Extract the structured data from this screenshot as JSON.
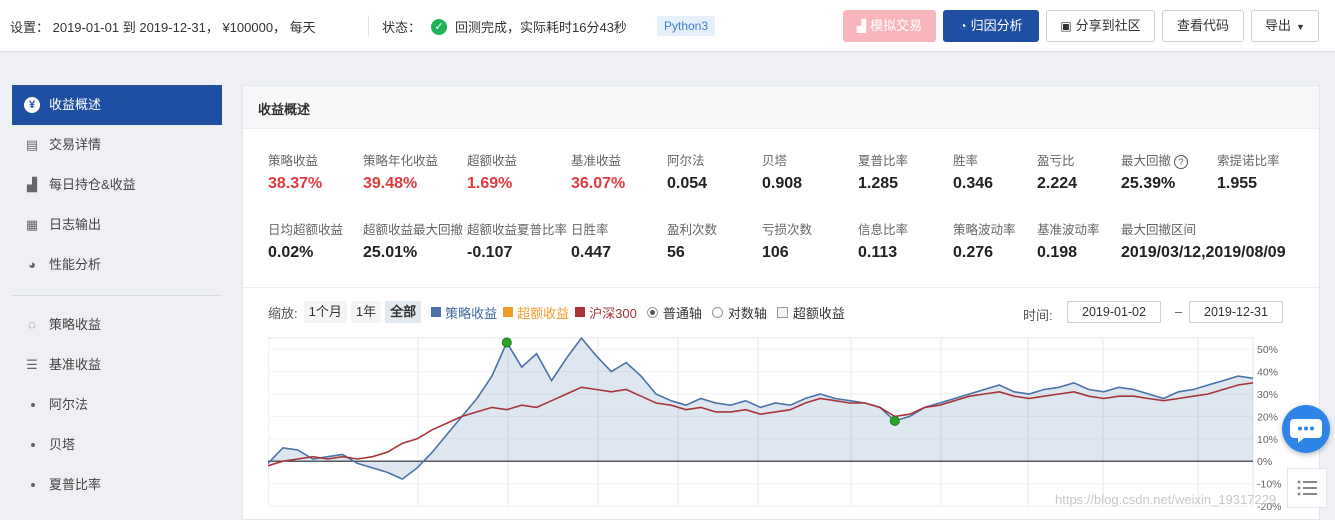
{
  "topbar": {
    "settings_text": "设置： 2019-01-01 到 2019-12-31， ¥100000， 每天",
    "status_label": "状态：",
    "status_text": "回测完成，实际耗时16分43秒",
    "python_badge": "Python3",
    "buttons": {
      "simulate": "模拟交易",
      "attribution": "归因分析",
      "share": "分享到社区",
      "view_code": "查看代码",
      "export": "导出"
    }
  },
  "sidebar": {
    "items": [
      {
        "label": "收益概述",
        "icon": "yen-icon"
      },
      {
        "label": "交易详情",
        "icon": "document-icon"
      },
      {
        "label": "每日持仓&收益",
        "icon": "bar-chart-icon"
      },
      {
        "label": "日志输出",
        "icon": "calendar-icon"
      },
      {
        "label": "性能分析",
        "icon": "pie-icon"
      },
      {
        "label": "策略收益",
        "icon": "bulb-icon"
      },
      {
        "label": "基准收益",
        "icon": "database-icon"
      },
      {
        "label": "阿尔法",
        "icon": "dot"
      },
      {
        "label": "贝塔",
        "icon": "dot"
      },
      {
        "label": "夏普比率",
        "icon": "dot"
      }
    ]
  },
  "panel": {
    "title": "收益概述",
    "metrics_row1": [
      {
        "label": "策略收益",
        "value": "38.37%",
        "color": "#e0393e"
      },
      {
        "label": "策略年化收益",
        "value": "39.48%",
        "color": "#e0393e"
      },
      {
        "label": "超额收益",
        "value": "1.69%",
        "color": "#e0393e"
      },
      {
        "label": "基准收益",
        "value": "36.07%",
        "color": "#e0393e"
      },
      {
        "label": "阿尔法",
        "value": "0.054"
      },
      {
        "label": "贝塔",
        "value": "0.908"
      },
      {
        "label": "夏普比率",
        "value": "1.285"
      },
      {
        "label": "胜率",
        "value": "0.346"
      },
      {
        "label": "盈亏比",
        "value": "2.224"
      },
      {
        "label": "最大回撤",
        "value": "25.39%"
      },
      {
        "label": "索提诺比率",
        "value": "1.955"
      }
    ],
    "metrics_row2": [
      {
        "label": "日均超额收益",
        "value": "0.02%"
      },
      {
        "label": "超额收益最大回撤",
        "value": "25.01%"
      },
      {
        "label": "超额收益夏普比率",
        "value": "-0.107"
      },
      {
        "label": "日胜率",
        "value": "0.447"
      },
      {
        "label": "盈利次数",
        "value": "56"
      },
      {
        "label": "亏损次数",
        "value": "106"
      },
      {
        "label": "信息比率",
        "value": "0.113"
      },
      {
        "label": "策略波动率",
        "value": "0.276"
      },
      {
        "label": "基准波动率",
        "value": "0.198"
      },
      {
        "label": "最大回撤区间",
        "value": "2019/03/12,2019/08/09"
      }
    ]
  },
  "chart_controls": {
    "zoom_label": "缩放:",
    "zoom_options": [
      "1个月",
      "1年",
      "全部"
    ],
    "zoom_selected": "全部",
    "legend": [
      {
        "label": "策略收益",
        "color": "#4a72a8"
      },
      {
        "label": "超额收益",
        "color": "#f59a2e"
      },
      {
        "label": "沪深300",
        "color": "#a8353a"
      }
    ],
    "axis_options": [
      {
        "label": "普通轴",
        "selected": true
      },
      {
        "label": "对数轴",
        "selected": false
      }
    ],
    "excess_checkbox": "超额收益",
    "time_label": "时间:",
    "date_from": "2019-01-02",
    "date_sep": "–",
    "date_to": "2019-12-31"
  },
  "chart_data": {
    "type": "line",
    "x_range": [
      "2019-01-02",
      "2019-12-31"
    ],
    "ylim": [
      -20,
      55
    ],
    "yticks": [
      "50%",
      "40%",
      "30%",
      "20%",
      "10%",
      "0%",
      "-10%",
      "-20%"
    ],
    "ytick_values": [
      50,
      40,
      30,
      20,
      10,
      0,
      -10,
      -20
    ],
    "series": [
      {
        "name": "策略收益",
        "color": "#4a72a8",
        "values": [
          -1,
          6,
          5,
          1,
          2,
          3,
          -1,
          -3,
          -5,
          -8,
          -3,
          4,
          12,
          20,
          28,
          38,
          53,
          42,
          48,
          36,
          46,
          55,
          47,
          40,
          44,
          38,
          30,
          27,
          25,
          28,
          26,
          25,
          27,
          24,
          26,
          25,
          28,
          30,
          28,
          27,
          26,
          24,
          18,
          20,
          24,
          26,
          28,
          30,
          32,
          34,
          31,
          30,
          32,
          33,
          35,
          32,
          31,
          33,
          32,
          30,
          28,
          31,
          32,
          34,
          36,
          38,
          37
        ]
      },
      {
        "name": "沪深300",
        "color": "#a8353a",
        "values": [
          -2,
          0,
          1,
          2,
          1,
          2,
          1,
          2,
          4,
          8,
          10,
          14,
          17,
          20,
          22,
          24,
          23,
          25,
          24,
          27,
          30,
          33,
          32,
          31,
          32,
          29,
          26,
          25,
          23,
          24,
          22,
          22,
          23,
          21,
          22,
          23,
          26,
          28,
          27,
          26,
          26,
          24,
          20,
          21,
          24,
          25,
          27,
          29,
          30,
          31,
          29,
          28,
          29,
          30,
          31,
          29,
          28,
          29,
          29,
          28,
          27,
          28,
          29,
          30,
          32,
          34,
          35
        ]
      }
    ],
    "markers": [
      {
        "name": "drawdown-start",
        "series": 0,
        "index": 16,
        "color": "#2aa52a"
      },
      {
        "name": "drawdown-end",
        "series": 0,
        "index": 42,
        "color": "#2aa52a"
      }
    ]
  },
  "watermark": "https://blog.csdn.net/weixin_19317229"
}
